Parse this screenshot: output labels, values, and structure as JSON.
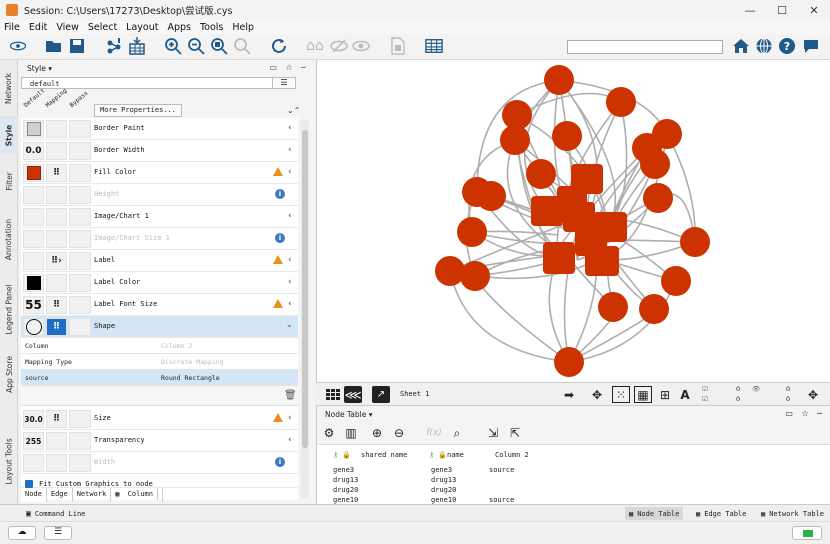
{
  "window": {
    "title": "Session: C:\\Users\\17273\\Desktop\\尝试版.cys",
    "controls": [
      "—",
      "☐",
      "✕"
    ]
  },
  "menu": [
    "File",
    "Edit",
    "View",
    "Select",
    "Layout",
    "Apps",
    "Tools",
    "Help"
  ],
  "toolbar": {
    "search_value": ""
  },
  "left_tabs": [
    "Network",
    "Style",
    "Filter",
    "Annotation",
    "Legend Panel",
    "App Store",
    "Layout Tools"
  ],
  "style_panel": {
    "title": "Style ▾",
    "style_selected": "default",
    "col_headers": [
      "Default",
      "Mapping",
      "Bypass"
    ],
    "more_properties": "More Properties...",
    "rows": [
      {
        "label": "Border Paint",
        "default": "",
        "mapping": "",
        "mark": "none"
      },
      {
        "label": "Border Width",
        "default": "0.0",
        "mapping": "",
        "mark": "none"
      },
      {
        "label": "Fill Color",
        "default": "",
        "mapping": "⠿",
        "mark": "warn"
      },
      {
        "label": "Height",
        "default": "",
        "mapping": "",
        "mark": "info"
      },
      {
        "label": "Image/Chart 1",
        "default": "",
        "mapping": "",
        "mark": "none"
      },
      {
        "label": "Image/Chart Size 1",
        "default": "",
        "mapping": "",
        "mark": "info"
      },
      {
        "label": "Label",
        "default": "",
        "mapping": "⠿›",
        "mark": "warn"
      },
      {
        "label": "Label Color",
        "default": "",
        "mapping": "",
        "mark": "none"
      },
      {
        "label": "Label Font Size",
        "default": "55",
        "mapping": "⠿",
        "mark": "warn"
      },
      {
        "label": "Shape",
        "default": "",
        "mapping": "⠿",
        "mark": "none"
      }
    ],
    "shape_detail": {
      "column_key": "Column",
      "column_val": "Column 2",
      "mapping_key": "Mapping Type",
      "mapping_val": "Discrete Mapping",
      "source_key": "source",
      "source_val": "Round Rectangle"
    },
    "rows2": [
      {
        "label": "Size",
        "default": "30.0",
        "mapping": "⠿",
        "mark": "warn"
      },
      {
        "label": "Transparency",
        "default": "255",
        "mapping": "",
        "mark": "none"
      },
      {
        "label": "Width",
        "default": "",
        "mapping": "",
        "mark": "info"
      }
    ],
    "fit_label": "Fit Custom Graphics to node",
    "tabs": [
      "Node",
      "Edge",
      "Network",
      "Column"
    ]
  },
  "network_bar": {
    "sheet": "Sheet 1",
    "counts": [
      "0",
      "0",
      "0",
      "0"
    ]
  },
  "table": {
    "title": "Node Table ▾",
    "headers": [
      "shared name",
      "name",
      "Column 2"
    ],
    "rows": [
      [
        "gene3",
        "gene3",
        "source"
      ],
      [
        "drug13",
        "drug13",
        ""
      ],
      [
        "drug20",
        "drug20",
        ""
      ],
      [
        "gene10",
        "gene10",
        "source"
      ]
    ],
    "tabs": [
      "Node Table",
      "Edge Table",
      "Network Table"
    ]
  },
  "status": {
    "command_line": "Command Line"
  },
  "colors": {
    "node": "#cc3300",
    "edge": "#a6a6a6",
    "accent": "#1f5a8a",
    "warn": "#e8901c",
    "info": "#3a7ac6"
  }
}
